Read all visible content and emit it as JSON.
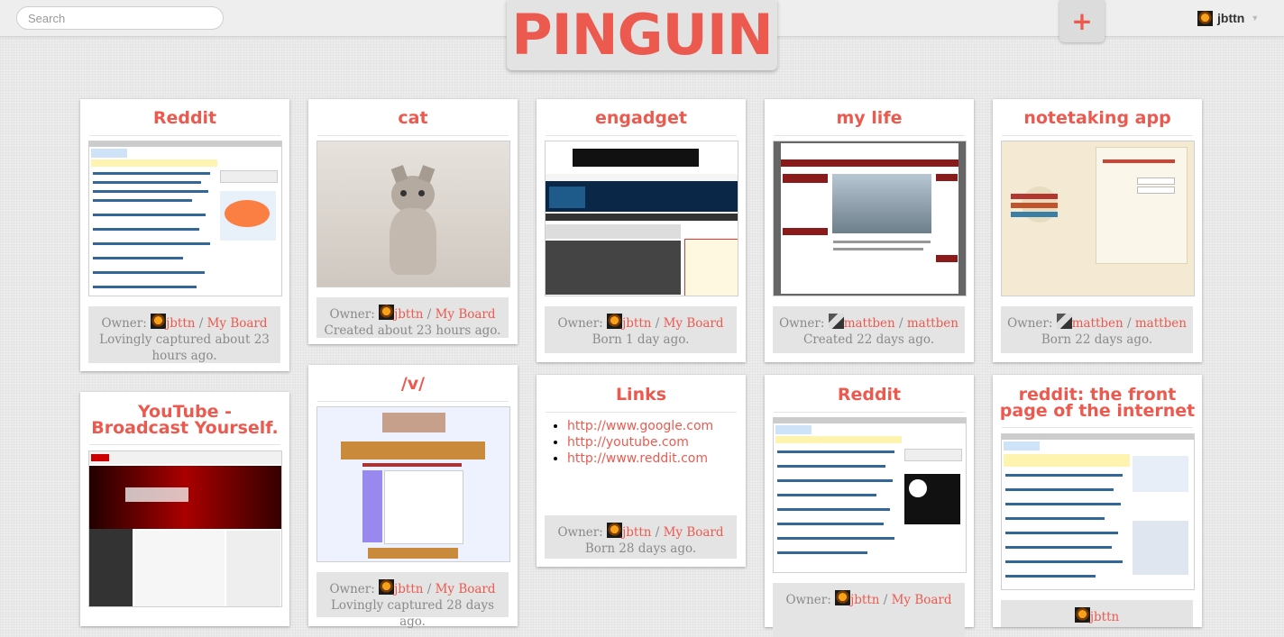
{
  "search": {
    "placeholder": "Search"
  },
  "brand": {
    "logo_text": "PINGUIN",
    "accent": "#ec5a4f"
  },
  "header": {
    "add_label": "+",
    "user_name": "jbttn"
  },
  "cards": [
    {
      "title": "Reddit",
      "owner": "jbttn",
      "board": "My Board",
      "owner_label": "Owner:",
      "caption": "Lovingly captured about 23 hours ago."
    },
    {
      "title": "cat",
      "owner": "jbttn",
      "board": "My Board",
      "owner_label": "Owner:",
      "caption": "Created about 23 hours ago."
    },
    {
      "title": "engadget",
      "owner": "jbttn",
      "board": "My Board",
      "owner_label": "Owner:",
      "caption": "Born 1 day ago."
    },
    {
      "title": "my life",
      "owner": "mattben",
      "board": "mattben",
      "owner_label": "Owner:",
      "caption": "Created 22 days ago."
    },
    {
      "title": "notetaking app",
      "owner": "mattben",
      "board": "mattben",
      "owner_label": "Owner:",
      "caption": "Born 22 days ago."
    },
    {
      "title": "YouTube - Broadcast Yourself.",
      "owner": "",
      "board": "",
      "owner_label": "",
      "caption": ""
    },
    {
      "title": "/v/",
      "owner": "jbttn",
      "board": "My Board",
      "owner_label": "Owner:",
      "caption": "Lovingly captured 28 days ago."
    },
    {
      "title": "Links",
      "owner": "jbttn",
      "board": "My Board",
      "owner_label": "Owner:",
      "caption": "Born 28 days ago.",
      "links": [
        "http://www.google.com",
        "http://youtube.com",
        "http://www.reddit.com"
      ]
    },
    {
      "title": "Reddit",
      "owner": "jbttn",
      "board": "My Board",
      "owner_label": "Owner:",
      "caption": ""
    },
    {
      "title": "reddit: the front page of the internet",
      "owner": "jbttn",
      "board": "",
      "owner_label": "",
      "caption": ""
    }
  ]
}
